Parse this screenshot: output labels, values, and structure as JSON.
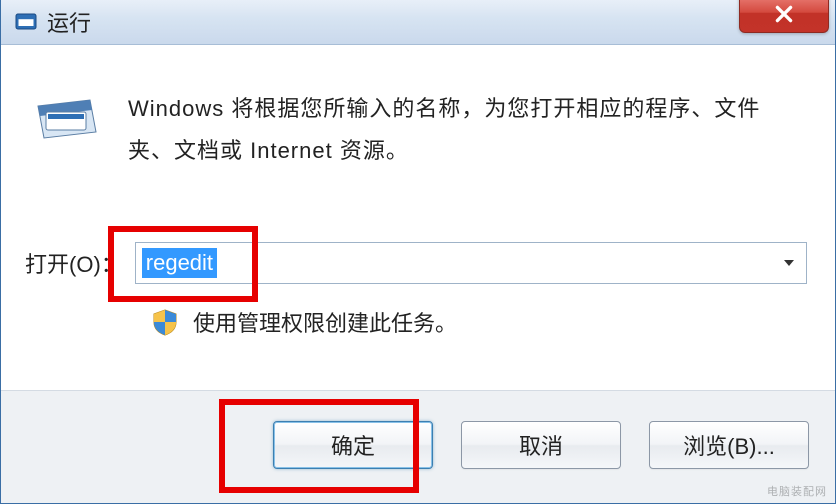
{
  "titlebar": {
    "title": "运行"
  },
  "description": "Windows 将根据您所输入的名称，为您打开相应的程序、文件夹、文档或 Internet 资源。",
  "open_label": "打开(O)：",
  "open_value": "regedit",
  "admin_note": "使用管理权限创建此任务。",
  "buttons": {
    "ok": "确定",
    "cancel": "取消",
    "browse": "浏览(B)..."
  },
  "watermark": "电脑装配网",
  "colors": {
    "highlight": "#e60000",
    "close_button": "#c23228",
    "select_bg": "#3399ff"
  }
}
